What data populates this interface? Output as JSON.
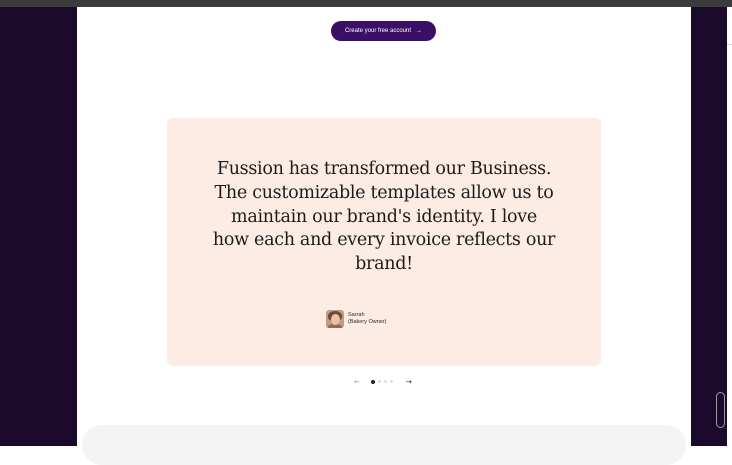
{
  "header": {
    "cta_label": "Create your free account",
    "cta_icon": "arrow-right-icon"
  },
  "testimonial": {
    "quote_lines": [
      "Fussion has transformed our Business.",
      "The customizable templates allow us to",
      "maintain our brand's identity. I love",
      "how each and every invoice reflects our",
      "brand!"
    ],
    "author_name": "Sarrah",
    "author_role": "(Bakery Owner)",
    "avatar_icon": "avatar-photo"
  },
  "carousel": {
    "prev_icon": "arrow-left-icon",
    "next_icon": "arrow-right-icon",
    "prev_glyph": "←",
    "next_glyph": "→",
    "total_slides": 4,
    "active_slide": 1
  },
  "colors": {
    "sidebar": "#1b0a2b",
    "cta_background": "#3c0f66",
    "card_background": "#fcece4",
    "page_background": "#ffffff"
  }
}
